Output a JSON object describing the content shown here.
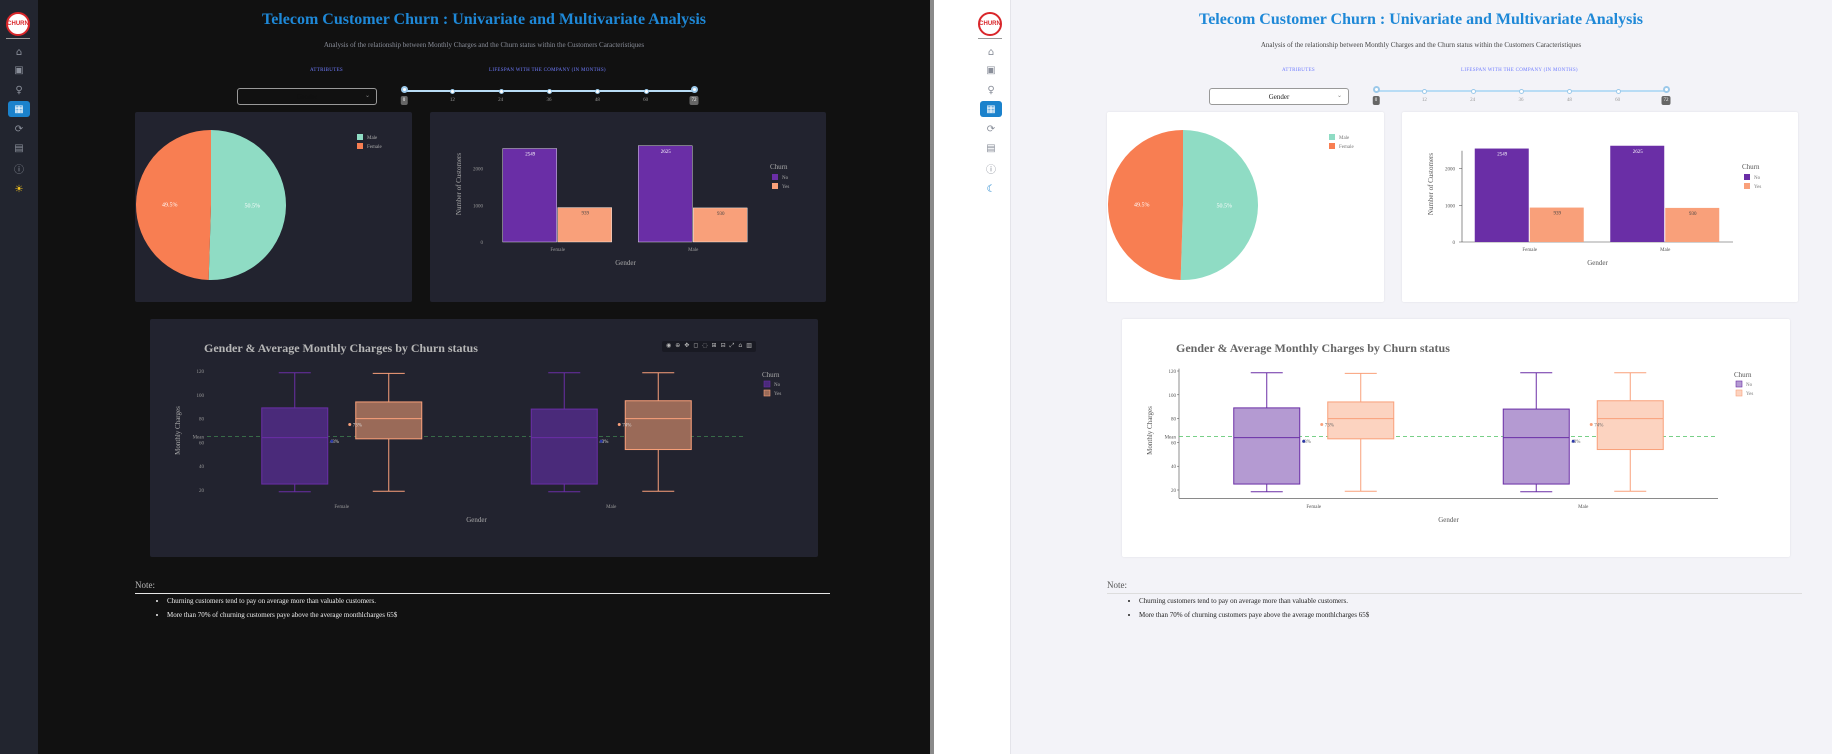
{
  "app": {
    "title": "Telecom Customer Churn : Univariate and Multivariate Analysis",
    "subtitle": "Analysis of the relationship between Monthly Charges and the Churn status within the Customers Caracteristiques",
    "logo_text": "CHURN"
  },
  "controls": {
    "attributes_label": "ATTRIBUTES",
    "lifespan_label": "LIFESPAN WITH THE COMPANY (IN MONTHS)",
    "dropdown_value": "Gender",
    "slider": {
      "ticks": [
        "0",
        "12",
        "24",
        "36",
        "48",
        "60",
        "72"
      ],
      "start_label": "0",
      "end_label": "72",
      "range": [
        0,
        72
      ]
    }
  },
  "sidebar": {
    "items": [
      {
        "icon": "home-icon",
        "glyph": "⌂"
      },
      {
        "icon": "profile-icon",
        "glyph": "▣"
      },
      {
        "icon": "lightbulb-icon",
        "glyph": "♀"
      },
      {
        "icon": "dashboard-icon",
        "glyph": "▦",
        "active": true
      },
      {
        "icon": "refresh-icon",
        "glyph": "⟳"
      },
      {
        "icon": "document-icon",
        "glyph": "▤"
      },
      {
        "icon": "info-icon",
        "glyph": "ⓘ"
      }
    ],
    "theme_toggle_dark": "☀",
    "theme_toggle_light": "☾"
  },
  "colors": {
    "accent": "#1e88d7",
    "pie_male": "#8fdcc4",
    "pie_female": "#f87e52",
    "no_churn": "#6a2ea6",
    "yes_churn": "#f9a07a",
    "mean_line": "#55c46a"
  },
  "chart_data": [
    {
      "type": "pie",
      "categories": [
        "Male",
        "Female"
      ],
      "values": [
        50.5,
        49.5
      ],
      "labels": [
        "50.5%",
        "49.5%"
      ]
    },
    {
      "type": "bar",
      "categories": [
        "Female",
        "Male"
      ],
      "xlabel": "Gender",
      "ylabel": "Number of Customers",
      "yticks": [
        "0",
        "1000",
        "2000"
      ],
      "ylim": [
        0,
        3000
      ],
      "legend_title": "Churn",
      "series": [
        {
          "name": "No",
          "values": [
            2549,
            2625
          ],
          "labels": [
            "2549",
            "2625"
          ]
        },
        {
          "name": "Yes",
          "values": [
            939,
            930
          ],
          "labels": [
            "939",
            "930"
          ]
        }
      ]
    },
    {
      "type": "box",
      "title": "Gender & Average Monthly Charges by Churn status",
      "xlabel": "Gender",
      "ylabel": "Monthly Charges",
      "categories": [
        "Female",
        "Male"
      ],
      "ylim": [
        15,
        125
      ],
      "yticks": [
        "20",
        "40",
        "60",
        "80",
        "100",
        "120"
      ],
      "mean_value": 65,
      "mean_label": "Mean",
      "legend_title": "Churn",
      "series": [
        {
          "name": "No",
          "boxes": [
            {
              "min": 18.5,
              "q1": 25,
              "median": 64,
              "q3": 89,
              "max": 118.5
            },
            {
              "min": 18.5,
              "q1": 25,
              "median": 64,
              "q3": 88,
              "max": 118.5
            }
          ]
        },
        {
          "name": "Yes",
          "boxes": [
            {
              "min": 19,
              "q1": 63,
              "median": 80,
              "q3": 94,
              "max": 118
            },
            {
              "min": 19,
              "q1": 54,
              "median": 80,
              "q3": 95,
              "max": 118.5
            }
          ]
        }
      ],
      "annotations": [
        {
          "category": "Female",
          "series": "Yes",
          "text": "73%"
        },
        {
          "category": "Female",
          "series": "No",
          "text": "43%"
        },
        {
          "category": "Male",
          "series": "Yes",
          "text": "74%"
        },
        {
          "category": "Male",
          "series": "No",
          "text": "43%"
        }
      ]
    }
  ],
  "modebar": [
    "◉",
    "⊕",
    "✥",
    "◻",
    "◌",
    "⊞",
    "⊟",
    "⤢",
    "⌂",
    "▥"
  ],
  "notes": {
    "label": "Note:",
    "items": [
      "Churning customers tend to pay on average more than valuable customers.",
      "More than 70% of churning customers paye above the average monthlcharges 65$"
    ]
  }
}
